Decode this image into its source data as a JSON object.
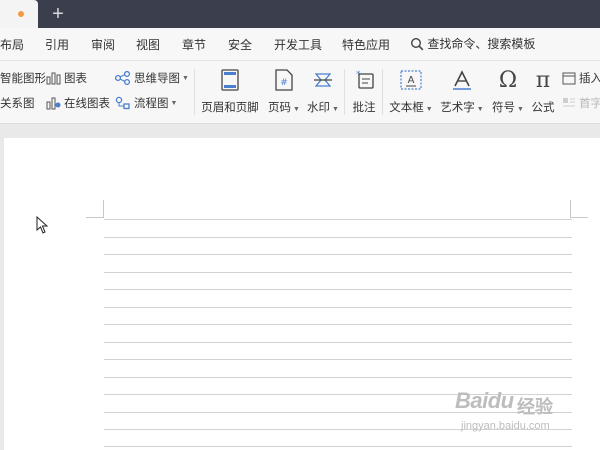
{
  "titlebar": {
    "new_tab": "+"
  },
  "menu": {
    "items": [
      "布局",
      "引用",
      "审阅",
      "视图",
      "章节",
      "安全",
      "开发工具",
      "特色应用"
    ],
    "search": "查找命令、搜索模板"
  },
  "ribbon": {
    "smart_graphic": "智能图形",
    "relation_graph": "关系图",
    "chart": "图表",
    "online_chart": "在线图表",
    "mind_map": "思维导图",
    "flowchart": "流程图",
    "header_footer": "页眉和页脚",
    "page_number": "页码",
    "watermark": "水印",
    "comment": "批注",
    "text_box": "文本框",
    "art_text": "艺术字",
    "symbol": "符号",
    "formula": "公式",
    "insert": "插入",
    "drop_cap": "首字"
  },
  "watermark": {
    "brand": "Baidu",
    "experience": "经验",
    "url": "jingyan.baidu.com"
  },
  "colors": {
    "titlebar": "#3b3f4d",
    "tab_dot": "#f39a45",
    "ribbon": "#f7f7f7",
    "page": "#ffffff",
    "accent_blue": "#4a7fd0"
  }
}
